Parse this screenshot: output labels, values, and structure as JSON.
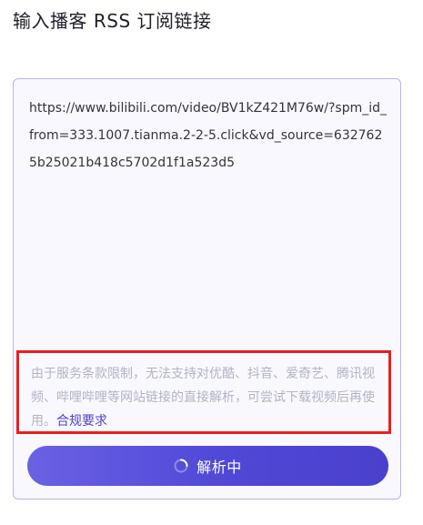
{
  "page": {
    "title": "输入播客 RSS 订阅链接"
  },
  "input": {
    "value": "https://www.bilibili.com/video/BV1kZ421M76w/?spm_id_from=333.1007.tianma.2-2-5.click&vd_source=6327625b25021b418c5702d1f1a523d5"
  },
  "notice": {
    "text": "由于服务条款限制，无法支持对优酷、抖音、爱奇艺、腾讯视频、哔哩哔哩等网站链接的直接解析，可尝试下载视频后再使用。",
    "link_label": "合规要求"
  },
  "button": {
    "label": "解析中",
    "icon": "spinner-icon"
  },
  "colors": {
    "accent": "#5048d6",
    "highlight_border": "#e8201c",
    "card_border": "#b7b5ee",
    "notice_text": "#b3b3c6"
  }
}
